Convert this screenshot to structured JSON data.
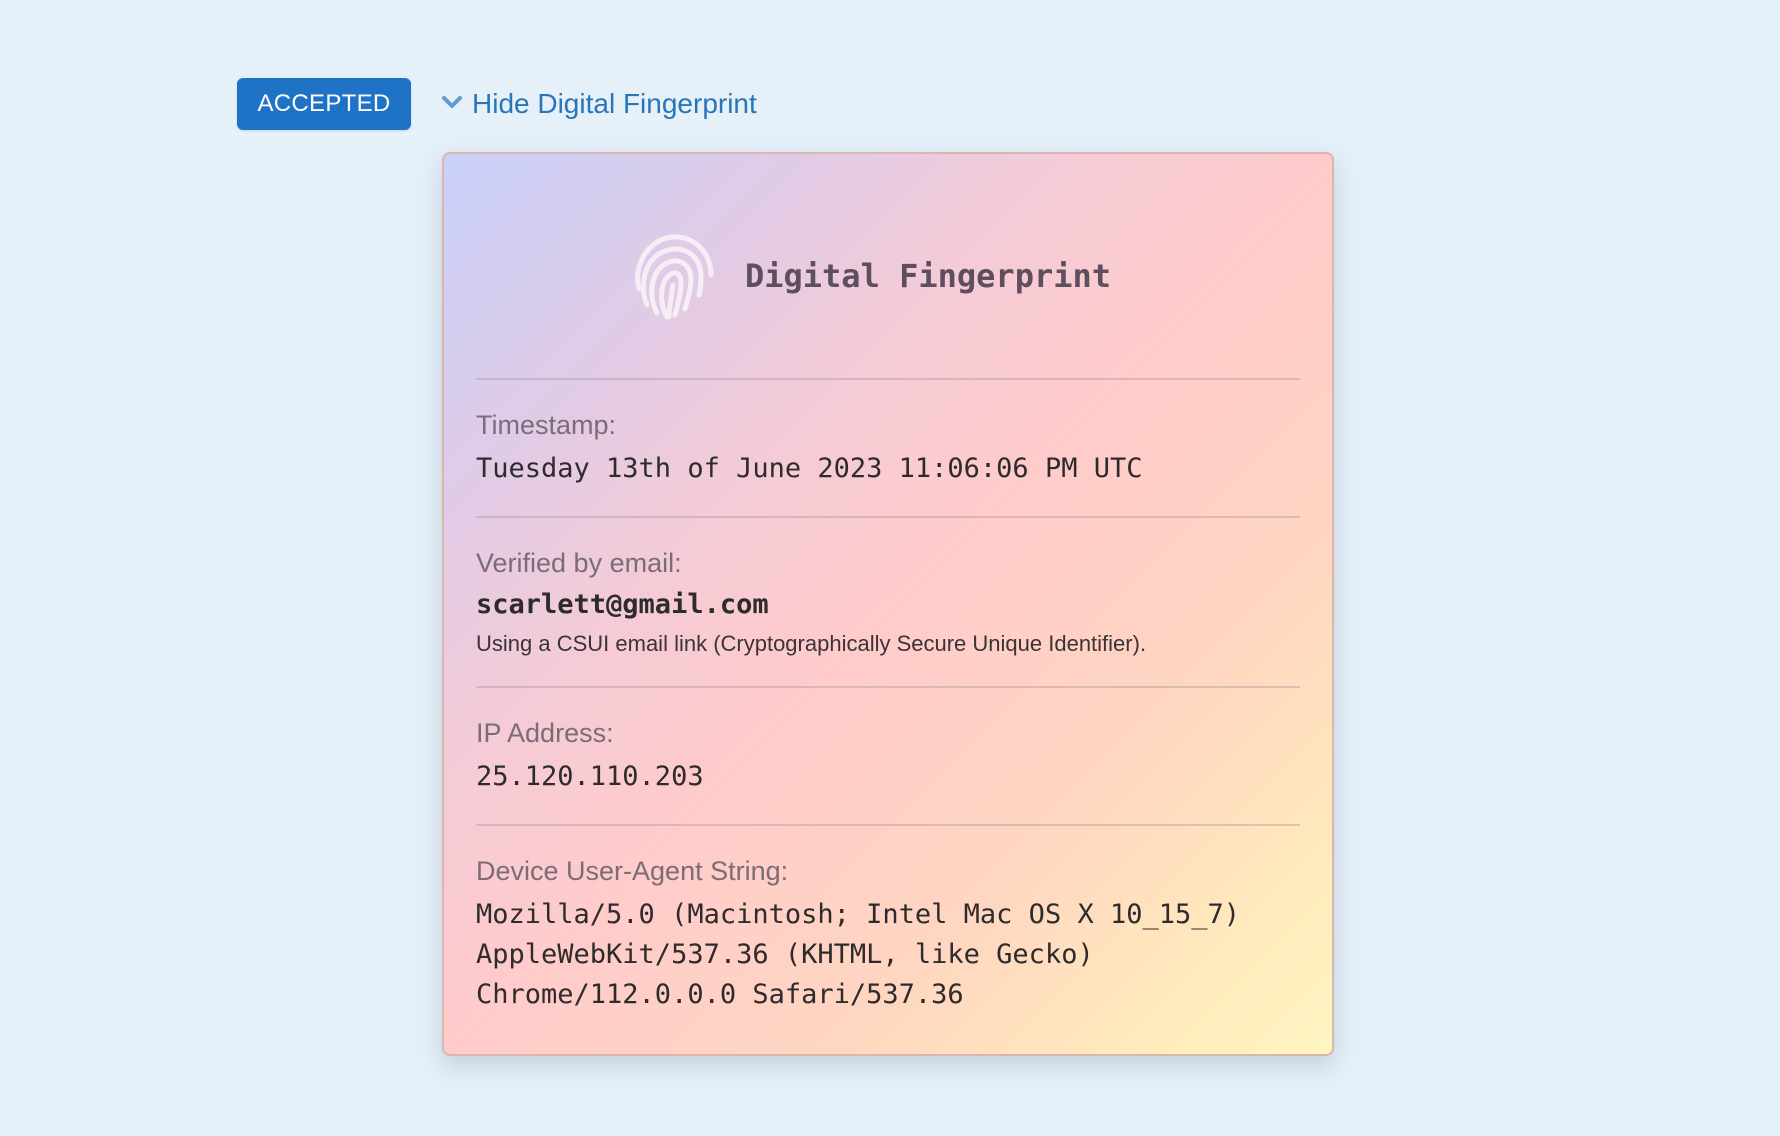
{
  "status": {
    "badge_label": "ACCEPTED",
    "toggle_label": "Hide Digital Fingerprint",
    "toggle_icon": "chevron-down-icon"
  },
  "card": {
    "title": "Digital Fingerprint",
    "icon": "fingerprint-icon",
    "timestamp": {
      "label": "Timestamp:",
      "value": "Tuesday 13th of June 2023 11:06:06 PM UTC"
    },
    "email": {
      "label": "Verified by email:",
      "value": "scarlett@gmail.com",
      "note": "Using a CSUI email link (Cryptographically Secure Unique Identifier)."
    },
    "ip": {
      "label": "IP Address:",
      "value": "25.120.110.203"
    },
    "user_agent": {
      "label": "Device User-Agent String:",
      "lines": [
        "Mozilla/5.0 (Macintosh; Intel Mac OS X 10_15_7)",
        "AppleWebKit/537.36 (KHTML, like Gecko)",
        "Chrome/112.0.0.0 Safari/537.36"
      ]
    }
  },
  "colors": {
    "background": "#e6f0f9",
    "badge": "#1f73c6",
    "link": "#2a75b9"
  }
}
